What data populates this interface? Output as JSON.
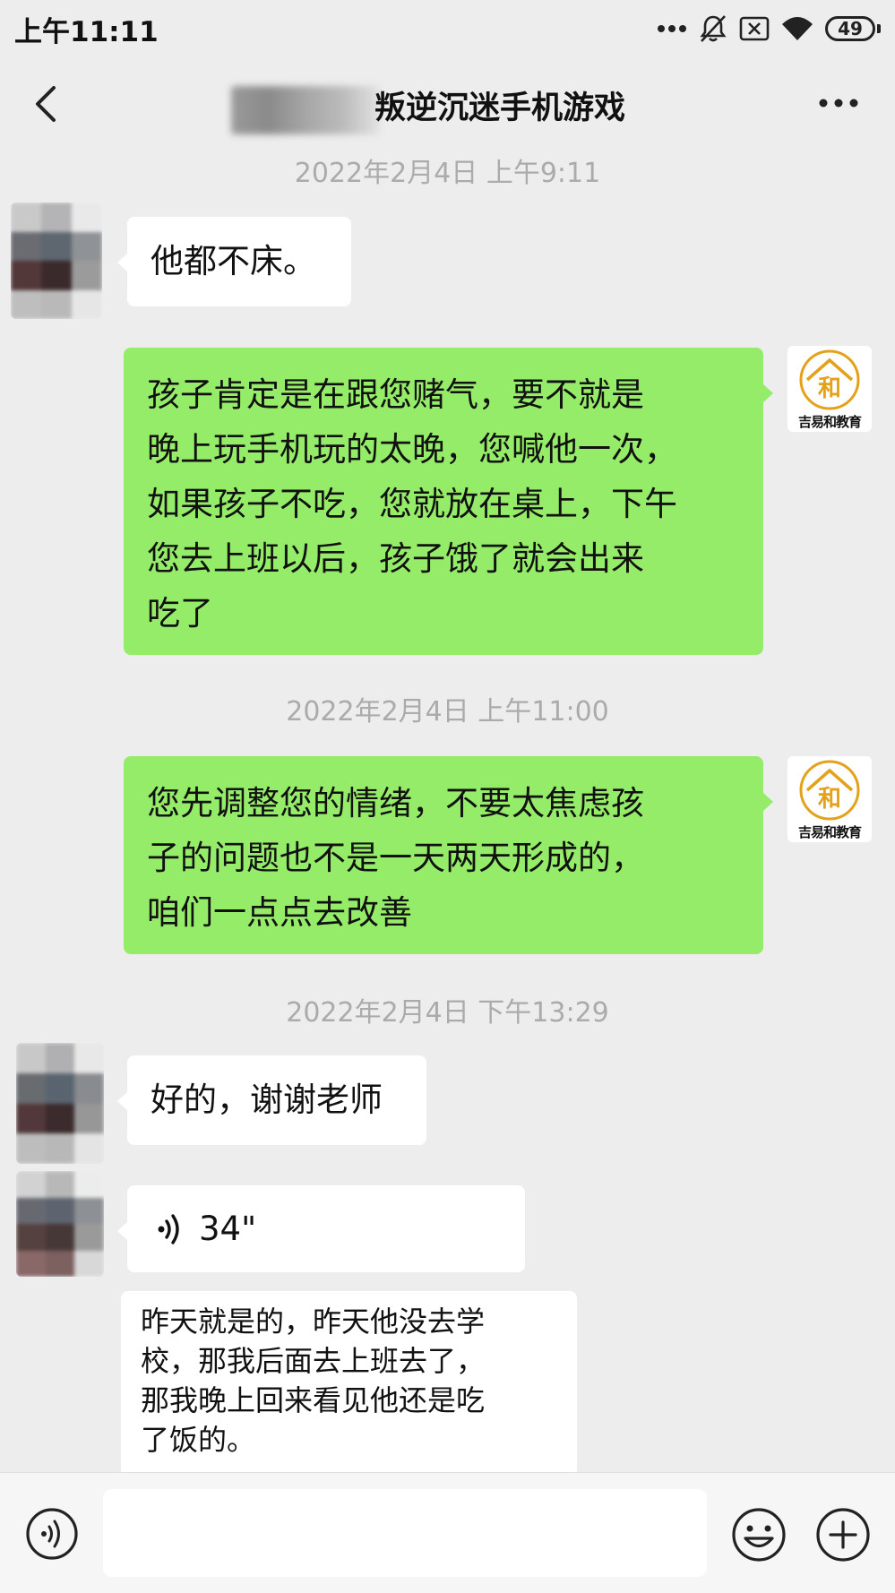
{
  "status_bar": {
    "time": "上午11:11",
    "battery": "49",
    "icons": [
      "more-dots-icon",
      "mute-icon",
      "no-sim-icon",
      "wifi-icon",
      "battery-icon"
    ]
  },
  "header": {
    "title": "叛逆沉迷手机游戏",
    "back_icon": "back-arrow-icon",
    "more_icon": "more-options-icon"
  },
  "messages": [
    {
      "type": "timestamp",
      "text": "2022年2月4日 上午9:11"
    },
    {
      "type": "incoming",
      "text": "他都不床。"
    },
    {
      "type": "outgoing",
      "text": "孩子肯定是在跟您赌气，要不就是\n晚上玩手机玩的太晚，您喊他一次，\n如果孩子不吃，您就放在桌上，下午\n您去上班以后，孩子饿了就会出来\n吃了"
    },
    {
      "type": "timestamp",
      "text": "2022年2月4日 上午11:00"
    },
    {
      "type": "outgoing",
      "text": "您先调整您的情绪，不要太焦虑孩\n子的问题也不是一天两天形成的，\n咱们一点点去改善"
    },
    {
      "type": "timestamp",
      "text": "2022年2月4日 下午13:29"
    },
    {
      "type": "incoming",
      "text": "好的，谢谢老师"
    },
    {
      "type": "incoming-voice",
      "duration": "34\""
    },
    {
      "type": "transcription",
      "text": "昨天就是的，昨天他没去学\n校，那我后面去上班去了，\n那我晚上回来看见他还是吃\n了饭的。"
    }
  ],
  "sender": {
    "logo_label": "吉易和教育",
    "logo_char": "和",
    "logo_color": "#e3a21a"
  },
  "colors": {
    "background": "#ededed",
    "outgoing_bubble": "#95ec69",
    "incoming_bubble": "#ffffff",
    "timestamp": "#ababab"
  },
  "input_bar": {
    "placeholder": "",
    "icons": [
      "voice-input-icon",
      "emoji-icon",
      "plus-icon"
    ]
  }
}
